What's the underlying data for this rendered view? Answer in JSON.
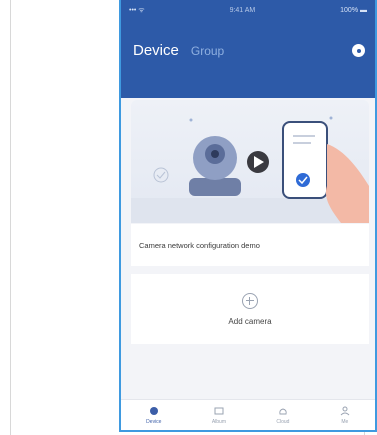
{
  "status_bar": {
    "left": "•••  ᯤ",
    "center": "9:41 AM",
    "right": "100% ▬"
  },
  "header": {
    "tab_device": "Device",
    "tab_group": "Group"
  },
  "banner": {
    "description": "Camera network configuration demo"
  },
  "add_camera": {
    "label": "Add camera"
  },
  "bottom_tabs": [
    {
      "label": "Device",
      "icon": "device-icon"
    },
    {
      "label": "Album",
      "icon": "album-icon"
    },
    {
      "label": "Cloud",
      "icon": "cloud-icon"
    },
    {
      "label": "Me",
      "icon": "user-icon"
    }
  ],
  "colors": {
    "header": "#2d5aa8",
    "accent": "#3f9ae0",
    "background": "#f3f4f8"
  }
}
